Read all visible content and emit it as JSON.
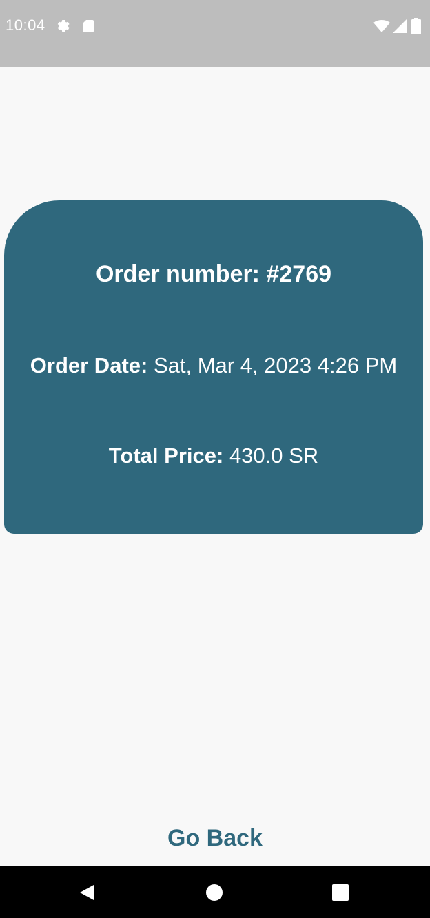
{
  "status_bar": {
    "time": "10:04",
    "left_icons": [
      "gear-icon",
      "sd-card-icon"
    ],
    "right_icons": [
      "wifi-icon",
      "cell-signal-icon",
      "battery-icon"
    ]
  },
  "order": {
    "number_label": "Order number:",
    "number_value": "#2769",
    "date_label": "Order Date:",
    "date_value": "Sat, Mar 4, 2023 4:26 PM",
    "price_label": "Total Price:",
    "price_value": "430.0 SR"
  },
  "actions": {
    "go_back_label": "Go Back"
  },
  "nav_bar": {
    "buttons": [
      "back-triangle-icon",
      "home-circle-icon",
      "recents-square-icon"
    ]
  },
  "colors": {
    "card": "#2f687d",
    "accent_text": "#2f687d",
    "status_bar": "#bdbdbd",
    "background": "#f8f8f8",
    "nav_bar": "#000000"
  }
}
